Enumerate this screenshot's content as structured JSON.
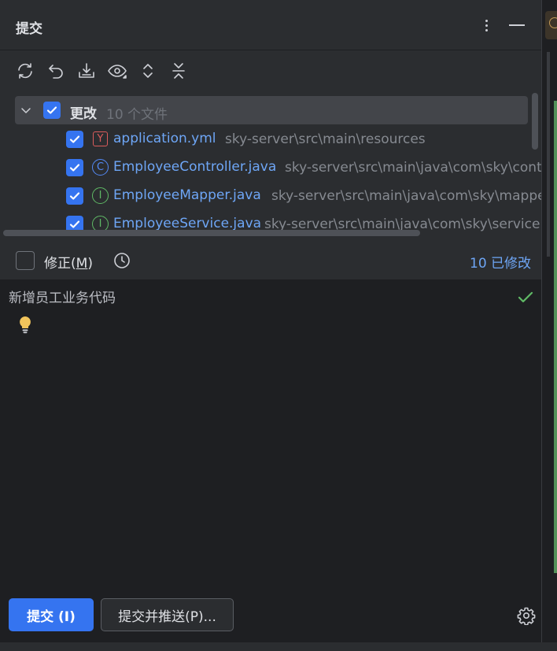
{
  "header": {
    "title": "提交"
  },
  "toolbar": {
    "items": [
      "refresh-icon",
      "rollback-icon",
      "shelve-icon",
      "preview-icon",
      "expand-all-icon",
      "collapse-all-icon"
    ]
  },
  "tree": {
    "group_label": "更改",
    "group_count": "10 个文件",
    "files": [
      {
        "icon": "Y",
        "name": "application.yml",
        "path": "sky-server\\src\\main\\resources"
      },
      {
        "icon": "C",
        "name": "EmployeeController.java",
        "path": "sky-server\\src\\main\\java\\com\\sky\\controller"
      },
      {
        "icon": "I",
        "name": "EmployeeMapper.java",
        "path": "sky-server\\src\\main\\java\\com\\sky\\mapper"
      },
      {
        "icon": "I",
        "name": "EmployeeService.java",
        "path": "sky-server\\src\\main\\java\\com\\sky\\service"
      }
    ]
  },
  "amend": {
    "label": "修正(",
    "mnemonic": "M",
    "label_end": ")",
    "modified": "10 已修改"
  },
  "message": {
    "text": "新增员工业务代码"
  },
  "footer": {
    "commit_label": "提交 (I)",
    "push_label": "提交并推送(P)..."
  },
  "colors": {
    "accent": "#3574f0",
    "link": "#6ea6f6",
    "success": "#5fb865",
    "yml": "#db5c5c"
  }
}
